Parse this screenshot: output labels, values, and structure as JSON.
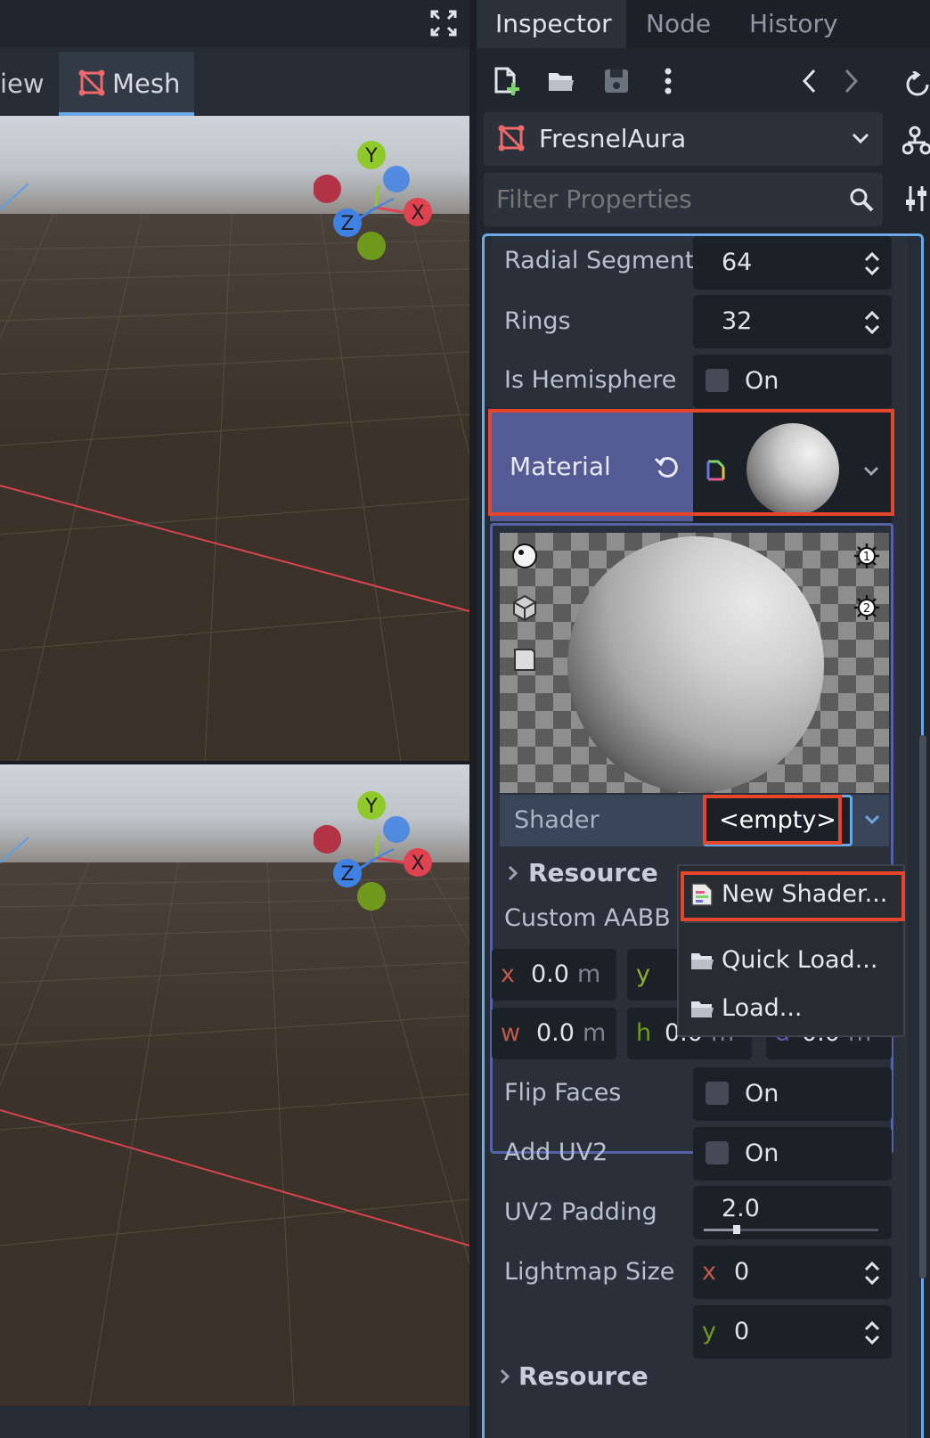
{
  "viewport": {
    "tabs": [
      {
        "label": "iew"
      },
      {
        "label": "Mesh"
      }
    ],
    "gizmo_axes": {
      "y": "Y",
      "x": "X",
      "z": "Z"
    }
  },
  "dock": {
    "tabs": [
      {
        "label": "Inspector"
      },
      {
        "label": "Node"
      },
      {
        "label": "History"
      }
    ]
  },
  "inspector": {
    "object_name": "FresnelAura",
    "filter_placeholder": "Filter Properties",
    "properties": {
      "radial_segments": {
        "label": "Radial Segment",
        "value": "64"
      },
      "rings": {
        "label": "Rings",
        "value": "32"
      },
      "is_hemisphere": {
        "label": "Is Hemisphere",
        "checkbox_label": "On",
        "checked": false
      },
      "material": {
        "label": "Material"
      },
      "shader": {
        "label": "Shader",
        "value": "<empty>"
      },
      "resource_sub": {
        "label": "Resource"
      },
      "custom_aabb": {
        "label": "Custom AABB",
        "x": {
          "axis": "x",
          "value": "0.0",
          "unit": "m"
        },
        "y": {
          "axis": "y"
        },
        "w": {
          "axis": "w",
          "value": "0.0",
          "unit": "m"
        },
        "h": {
          "axis": "h",
          "value": "0.0",
          "unit": "m"
        },
        "d": {
          "axis": "d",
          "value": "0.0",
          "unit": "m"
        }
      },
      "flip_faces": {
        "label": "Flip Faces",
        "checkbox_label": "On",
        "checked": false
      },
      "add_uv2": {
        "label": "Add UV2",
        "checkbox_label": "On",
        "checked": false
      },
      "uv2_padding": {
        "label": "UV2 Padding",
        "value": "2.0",
        "slider_fraction": 0.19
      },
      "lightmap_size": {
        "label": "Lightmap Size",
        "x": {
          "axis": "x",
          "value": "0"
        },
        "y": {
          "axis": "y",
          "value": "0"
        }
      },
      "resource": {
        "label": "Resource"
      }
    }
  },
  "shader_menu": {
    "items": [
      {
        "label": "New Shader..."
      },
      {
        "label": "Quick Load..."
      },
      {
        "label": "Load..."
      }
    ]
  },
  "colors": {
    "accent": "#6aa9e6",
    "highlight": "#e5462b",
    "material_row": "#545a93",
    "axis_x": "#e0424f",
    "axis_y": "#8fca2a",
    "axis_z": "#3f82e6"
  }
}
